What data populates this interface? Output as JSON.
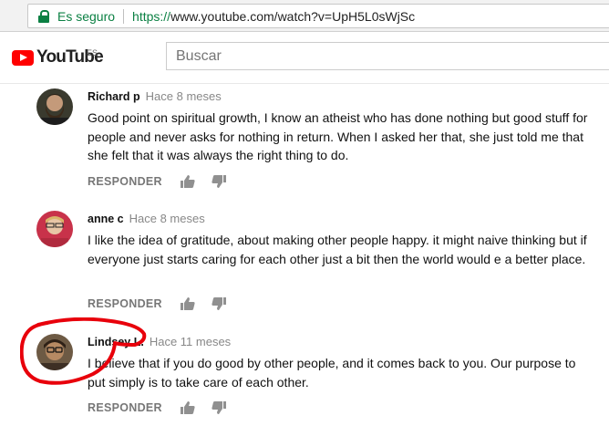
{
  "browser": {
    "secure_label": "Es seguro",
    "url_scheme": "https://",
    "url_rest": "www.youtube.com/watch?v=UpH5L0sWjSc"
  },
  "header": {
    "logo_text": "YouTube",
    "region": "ES",
    "search_placeholder": "Buscar"
  },
  "comments": [
    {
      "author": "Richard p",
      "time": "Hace 8 meses",
      "text": "Good point on spiritual growth, I know an atheist who has done nothing but good stuff for people and never asks for nothing in return. When I asked her that, she just told me that she felt that it was always the right thing to do.",
      "reply_label": "RESPONDER"
    },
    {
      "author": "anne c",
      "time": "Hace 8 meses",
      "text": "I like the idea of gratitude, about making other people happy. it might naive thinking but if everyone just starts caring for each other just a bit then the world would e a better place.",
      "reply_label": "RESPONDER"
    },
    {
      "author": "Lindsey L.",
      "time": "Hace 11 meses",
      "text": "I believe that if you do good by other people, and it comes back to you. Our purpose to put simply is to take care of each other.",
      "reply_label": "RESPONDER"
    }
  ],
  "colors": {
    "secure_green": "#0b8043",
    "youtube_red": "#ff0000",
    "annotation_red": "#e8000b"
  }
}
